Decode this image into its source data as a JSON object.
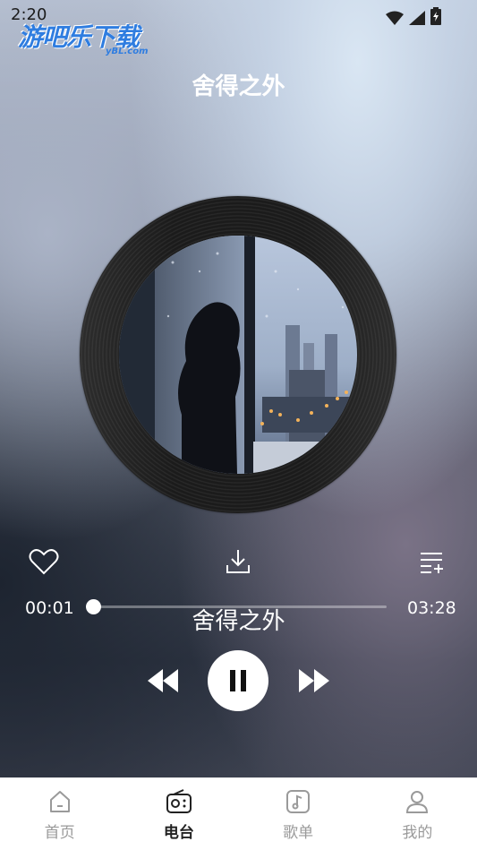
{
  "status": {
    "time": "2:20"
  },
  "watermark": {
    "text": "游吧乐下载",
    "sub": "yBL.com"
  },
  "song": {
    "title": "舍得之外",
    "lyric": "舍得之外"
  },
  "playback": {
    "current": "00:01",
    "total": "03:28",
    "progress": 0.005
  },
  "nav": {
    "items": [
      {
        "label": "首页",
        "icon": "home-icon"
      },
      {
        "label": "电台",
        "icon": "radio-icon"
      },
      {
        "label": "歌单",
        "icon": "music-note-icon"
      },
      {
        "label": "我的",
        "icon": "user-icon"
      }
    ],
    "active": "电台"
  }
}
